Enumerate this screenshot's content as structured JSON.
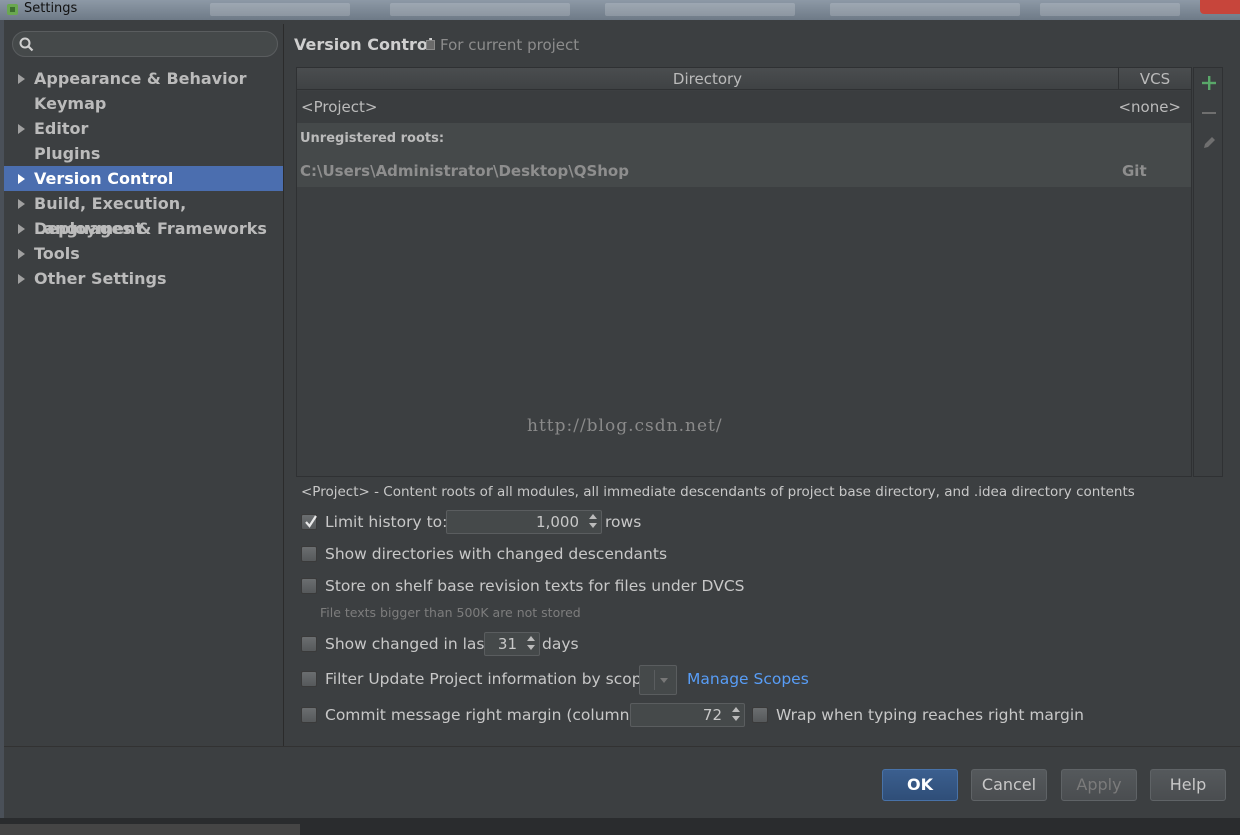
{
  "window": {
    "title": "Settings"
  },
  "sidebar": {
    "search": {
      "value": "",
      "placeholder": ""
    },
    "items": [
      {
        "label": "Appearance & Behavior",
        "expandable": true,
        "selected": false
      },
      {
        "label": "Keymap",
        "expandable": false,
        "selected": false
      },
      {
        "label": "Editor",
        "expandable": true,
        "selected": false
      },
      {
        "label": "Plugins",
        "expandable": false,
        "selected": false
      },
      {
        "label": "Version Control",
        "expandable": true,
        "selected": true
      },
      {
        "label": "Build, Execution, Deployment",
        "expandable": true,
        "selected": false
      },
      {
        "label": "Languages & Frameworks",
        "expandable": true,
        "selected": false
      },
      {
        "label": "Tools",
        "expandable": true,
        "selected": false
      },
      {
        "label": "Other Settings",
        "expandable": true,
        "selected": false
      }
    ]
  },
  "header": {
    "title": "Version Control",
    "subtitle": "For current project"
  },
  "table": {
    "columns": {
      "directory": "Directory",
      "vcs": "VCS"
    },
    "project_row": {
      "directory": "<Project>",
      "vcs": "<none>"
    },
    "unregistered_label": "Unregistered roots:",
    "unregistered_row": {
      "directory": "C:\\Users\\Administrator\\Desktop\\QShop",
      "vcs": "Git"
    },
    "watermark": "http://blog.csdn.net/"
  },
  "description": "<Project> - Content roots of all modules, all immediate descendants of project base directory, and .idea directory contents",
  "options": {
    "limit_history": {
      "label": "Limit history to:",
      "checked": true,
      "value": "1,000",
      "suffix": "rows"
    },
    "show_dirs": {
      "label": "Show directories with changed descendants",
      "checked": false
    },
    "store_shelf": {
      "label": "Store on shelf base revision texts for files under DVCS",
      "checked": false,
      "hint": "File texts bigger than 500K are not stored"
    },
    "show_changed": {
      "label": "Show changed in last",
      "checked": false,
      "value": "31",
      "suffix": "days"
    },
    "filter_update": {
      "label": "Filter Update Project information by scope",
      "checked": false,
      "link": "Manage Scopes"
    },
    "commit_margin": {
      "label": "Commit message right margin (columns):",
      "checked": false,
      "value": "72"
    },
    "wrap_typing": {
      "label": "Wrap when typing reaches right margin",
      "checked": false
    }
  },
  "footer": {
    "ok": "OK",
    "cancel": "Cancel",
    "apply": "Apply",
    "help": "Help"
  },
  "colors": {
    "selection": "#4b6eaf",
    "link": "#589df6",
    "add": "#59a869",
    "background": "#3c3f41"
  }
}
